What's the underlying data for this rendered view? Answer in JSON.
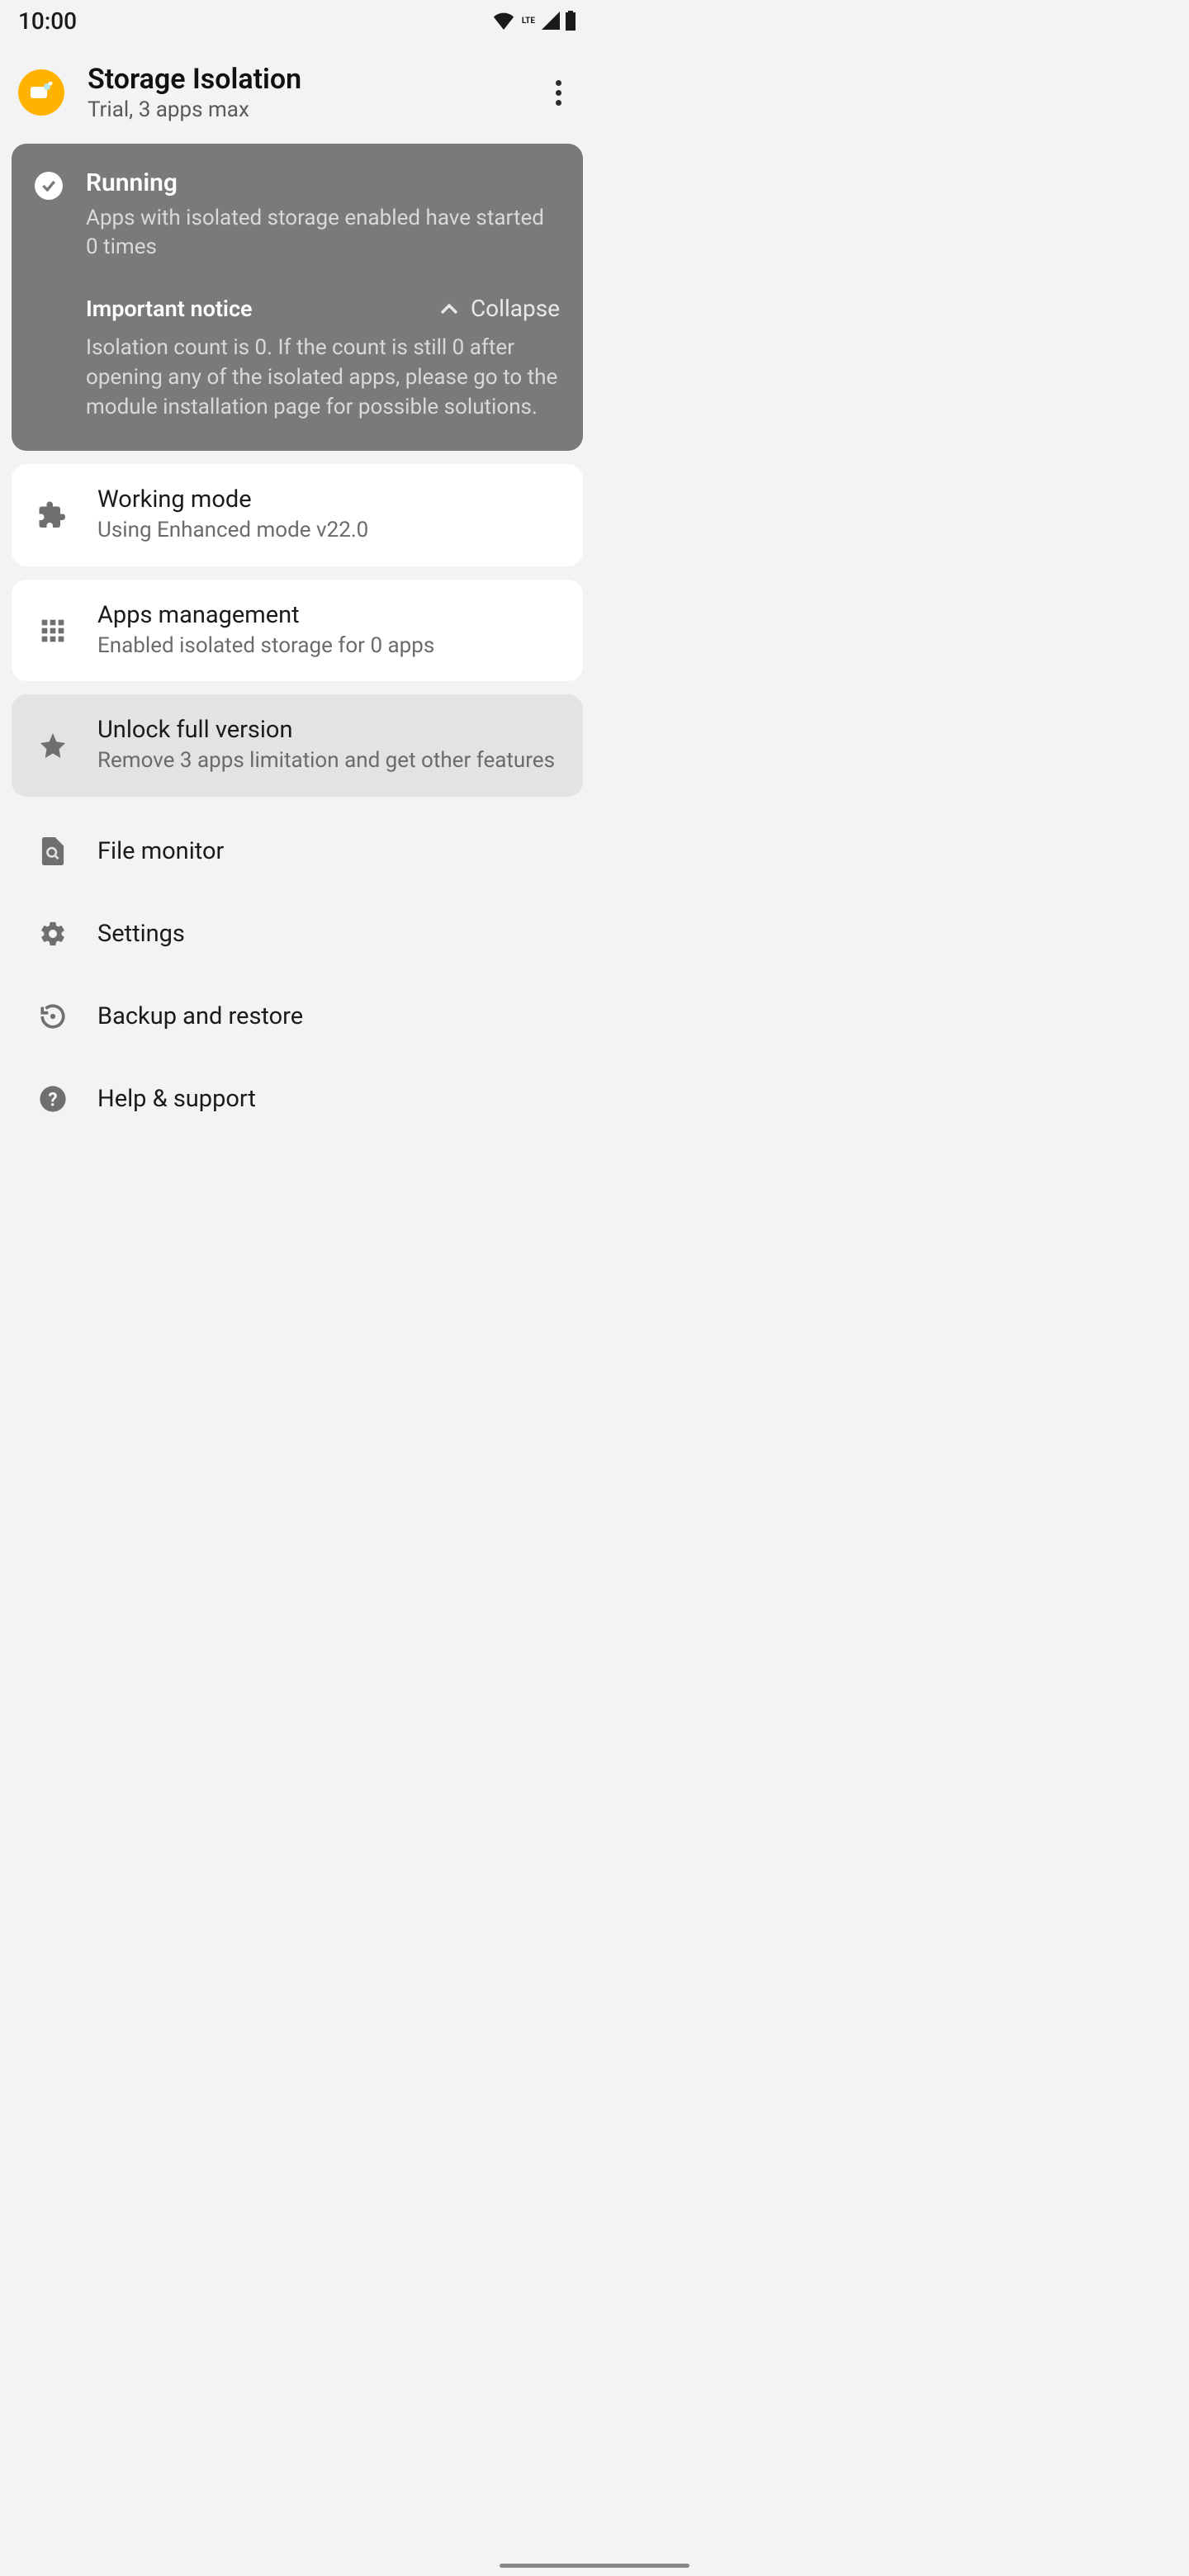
{
  "status_bar": {
    "time": "10:00",
    "network_label": "LTE"
  },
  "header": {
    "title": "Storage Isolation",
    "subtitle": "Trial, 3 apps max"
  },
  "status_card": {
    "heading": "Running",
    "text": "Apps with isolated storage enabled have started 0 times",
    "notice_title": "Important notice",
    "collapse_label": "Collapse",
    "notice_text": "Isolation count is 0. If the count is still 0 after opening any of the isolated apps, please go to the module installation page for possible solutions."
  },
  "cards": {
    "working_mode": {
      "title": "Working mode",
      "sub": "Using Enhanced mode v22.0"
    },
    "apps_management": {
      "title": "Apps management",
      "sub": "Enabled isolated storage for 0 apps"
    },
    "unlock": {
      "title": "Unlock full version",
      "sub": "Remove 3 apps limitation and get other features"
    }
  },
  "rows": {
    "file_monitor": "File monitor",
    "settings": "Settings",
    "backup_restore": "Backup and restore",
    "help_support": "Help & support"
  }
}
